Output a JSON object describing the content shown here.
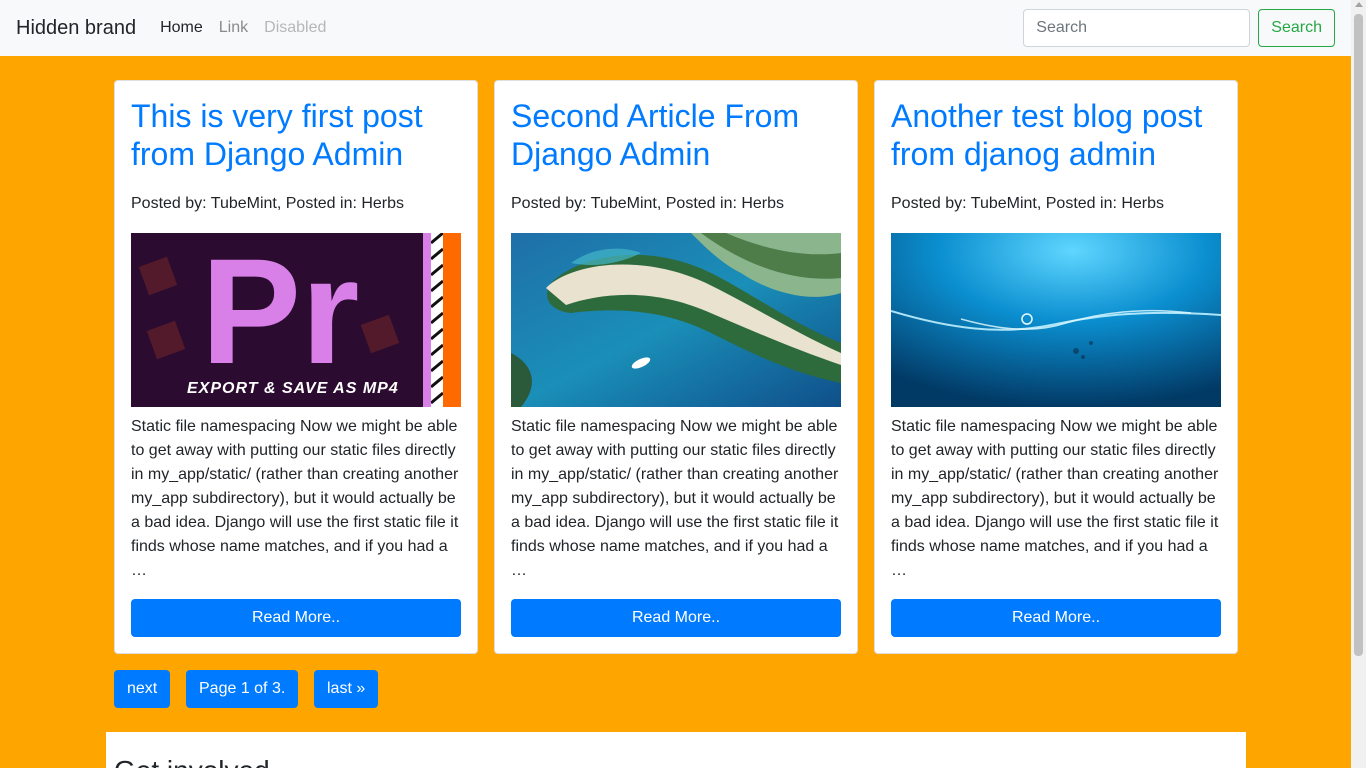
{
  "navbar": {
    "brand": "Hidden brand",
    "links": [
      {
        "label": "Home",
        "state": "active"
      },
      {
        "label": "Link",
        "state": "normal"
      },
      {
        "label": "Disabled",
        "state": "disabled"
      }
    ],
    "search_placeholder": "Search",
    "search_button": "Search"
  },
  "posts": [
    {
      "title": "This is very first post from Django Admin",
      "meta": "Posted by: TubeMint, Posted in: Herbs",
      "image_text": "EXPORT & SAVE AS MP4",
      "image_logo": "Pr",
      "excerpt": "Static file namespacing Now we might be able to get away with putting our static files directly in my_app/static/ (rather than creating another my_app subdirectory), but it would actually be a bad idea. Django will use the first static file it finds whose name matches, and if you had a …",
      "button": "Read More.."
    },
    {
      "title": "Second Article From Django Admin",
      "meta": "Posted by: TubeMint, Posted in: Herbs",
      "excerpt": "Static file namespacing Now we might be able to get away with putting our static files directly in my_app/static/ (rather than creating another my_app subdirectory), but it would actually be a bad idea. Django will use the first static file it finds whose name matches, and if you had a …",
      "button": "Read More.."
    },
    {
      "title": "Another test blog post from djanog admin",
      "meta": "Posted by: TubeMint, Posted in: Herbs",
      "excerpt": "Static file namespacing Now we might be able to get away with putting our static files directly in my_app/static/ (rather than creating another my_app subdirectory), but it would actually be a bad idea. Django will use the first static file it finds whose name matches, and if you had a …",
      "button": "Read More.."
    }
  ],
  "pagination": {
    "next": "next",
    "current": "Page 1 of 3.",
    "last": "last »"
  },
  "footer": {
    "title": "Get involved"
  },
  "colors": {
    "page_background": "#ffa500",
    "primary": "#007bff",
    "success": "#28a745"
  }
}
